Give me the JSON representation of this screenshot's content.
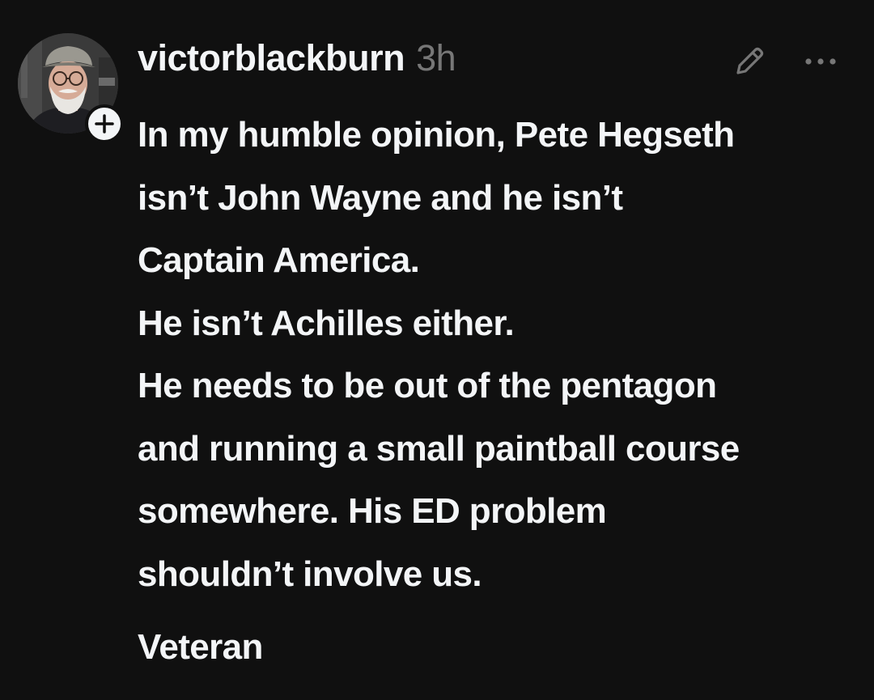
{
  "post": {
    "username": "victorblackburn",
    "timestamp": "3h",
    "icons": {
      "avatar": "user-avatar-photo",
      "follow": "plus-icon",
      "edit": "pencil-icon",
      "more": "more-horizontal-icon"
    },
    "body_lines": [
      "In my humble opinion, Pete Hegseth",
      "isn’t John Wayne and he isn’t",
      "Captain America.",
      "He isn’t Achilles either.",
      "He needs to be out of the pentagon",
      "and running a small paintball course",
      "somewhere. His ED problem",
      "shouldn’t involve us."
    ],
    "signature": "Veteran"
  },
  "colors": {
    "background": "#101010",
    "text_primary": "#f3f5f7",
    "text_secondary": "#777777"
  }
}
